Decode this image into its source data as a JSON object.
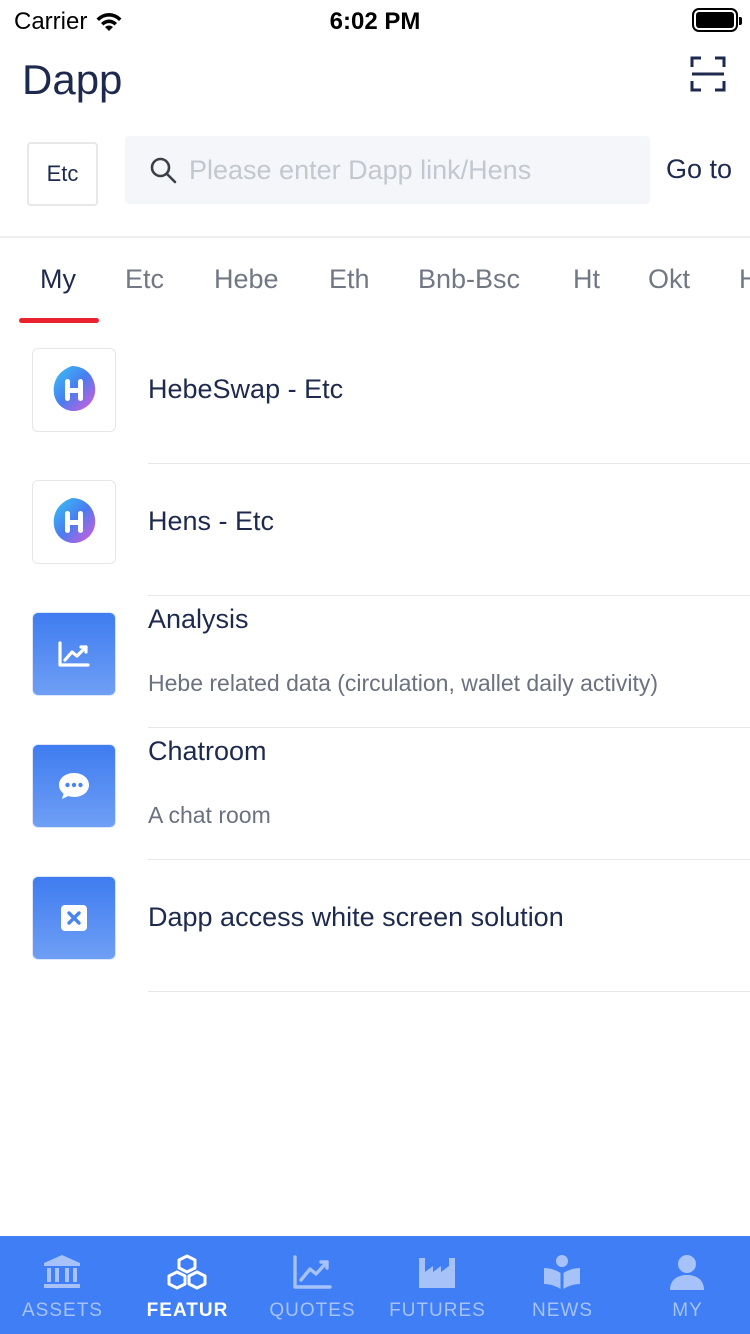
{
  "status_bar": {
    "carrier": "Carrier",
    "time": "6:02 PM"
  },
  "header": {
    "title": "Dapp",
    "scan_icon": "scan-icon"
  },
  "search": {
    "chain_selector": "Etc",
    "placeholder": "Please enter Dapp link/Hens",
    "value": "",
    "go_label": "Go to"
  },
  "tabs": [
    {
      "label": "My",
      "active": true
    },
    {
      "label": "Etc"
    },
    {
      "label": "Hebe"
    },
    {
      "label": "Eth"
    },
    {
      "label": "Bnb-Bsc"
    },
    {
      "label": "Ht"
    },
    {
      "label": "Okt"
    },
    {
      "label": "H"
    }
  ],
  "dapps": [
    {
      "title": "HebeSwap - Etc",
      "description": "",
      "icon": "hebe-logo-icon"
    },
    {
      "title": "Hens - Etc",
      "description": "",
      "icon": "hebe-logo-icon"
    },
    {
      "title": "Analysis",
      "description": "Hebe related data (circulation, wallet daily activity)",
      "icon": "chart-icon"
    },
    {
      "title": "Chatroom",
      "description": "A chat room",
      "icon": "chat-bubble-icon"
    },
    {
      "title": "Dapp access white screen solution",
      "description": "",
      "icon": "close-box-icon"
    }
  ],
  "tab_bar": [
    {
      "label": "ASSETS",
      "icon": "bank-icon"
    },
    {
      "label": "FEATUR",
      "icon": "cubes-icon",
      "active": true
    },
    {
      "label": "QUOTES",
      "icon": "trend-chart-icon"
    },
    {
      "label": "FUTURES",
      "icon": "factory-icon"
    },
    {
      "label": "NEWS",
      "icon": "book-reader-icon"
    },
    {
      "label": "MY",
      "icon": "user-icon"
    }
  ],
  "colors": {
    "accent": "#3f7ef5",
    "tab_indicator": "#e8232e",
    "text_primary": "#1d2a4d"
  }
}
